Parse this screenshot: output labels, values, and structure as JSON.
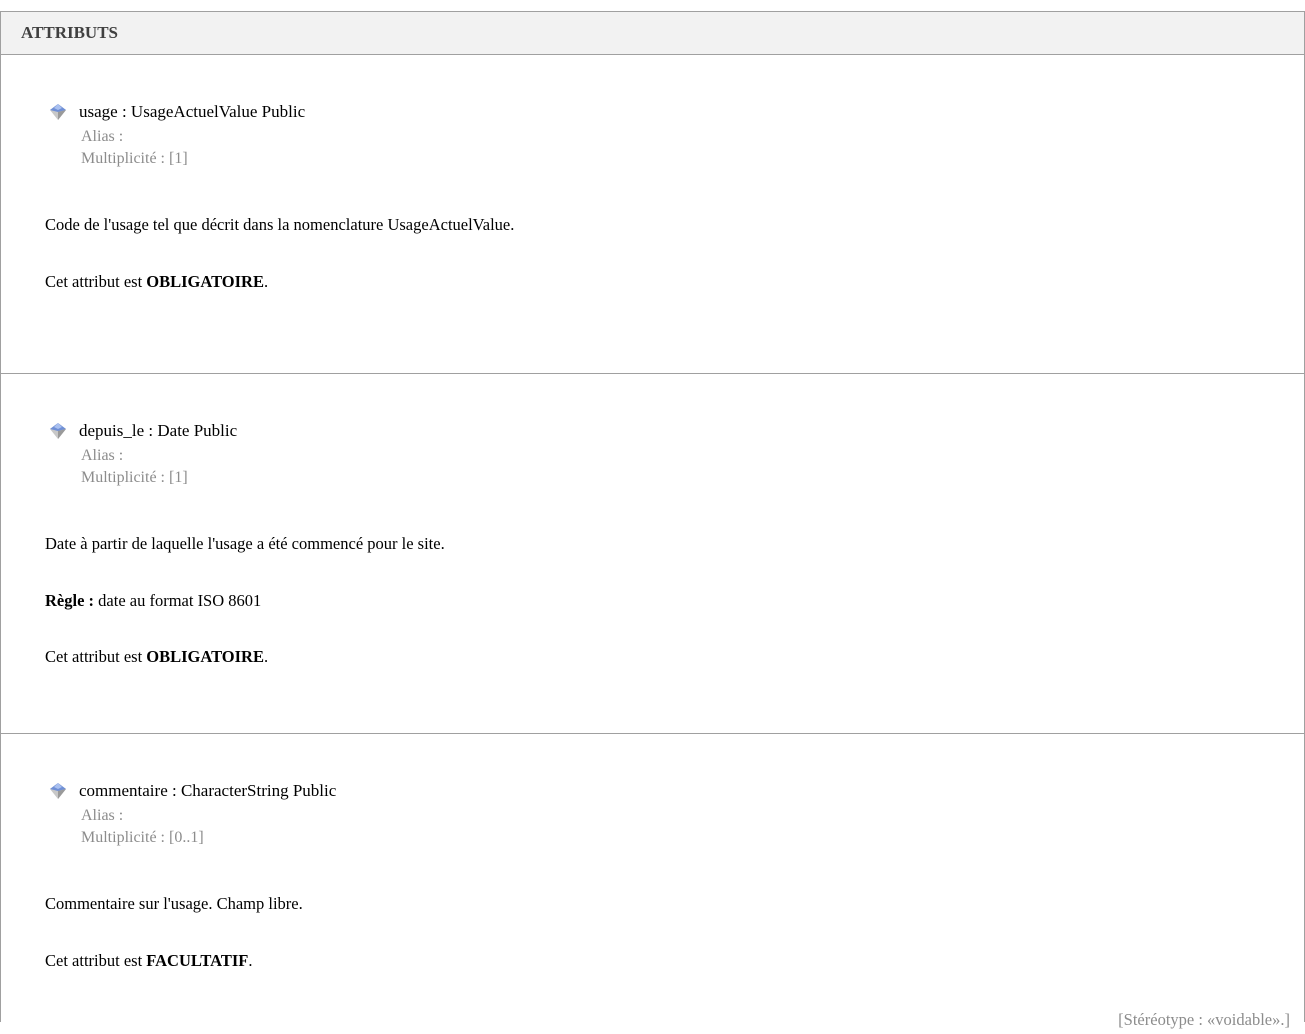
{
  "header": {
    "title": "ATTRIBUTS"
  },
  "attributes": [
    {
      "signature": "usage : UsageActuelValue  Public",
      "alias": "Alias :",
      "multiplicity": "Multiplicité : [1]",
      "description": "Code de l'usage tel que décrit dans la nomenclature UsageActuelValue.",
      "status_prefix": "Cet attribut est ",
      "status": "OBLIGATOIRE",
      "status_suffix": "."
    },
    {
      "signature": "depuis_le : Date  Public",
      "alias": "Alias :",
      "multiplicity": "Multiplicité : [1]",
      "description": "Date à partir de laquelle l'usage a été commencé pour le site.",
      "rule_label": "Règle :",
      "rule_text": " date au format ISO 8601",
      "status_prefix": "Cet attribut est ",
      "status": "OBLIGATOIRE",
      "status_suffix": "."
    },
    {
      "signature": "commentaire : CharacterString  Public",
      "alias": "Alias :",
      "multiplicity": "Multiplicité : [0..1]",
      "description": "Commentaire sur l'usage. Champ libre.",
      "status_prefix": "Cet attribut est ",
      "status": "FACULTATIF",
      "status_suffix": ".",
      "stereotype": "[Stéréotype : «voidable».]"
    }
  ],
  "icons": {
    "attribute_icon": "attribute-gem-icon"
  },
  "colors": {
    "gem_top": "#6f8fd6",
    "gem_bottom": "#c8c8c8",
    "meta_text": "#8c8c8c",
    "border": "#a0a0a0",
    "header_bg": "#f2f2f2"
  }
}
